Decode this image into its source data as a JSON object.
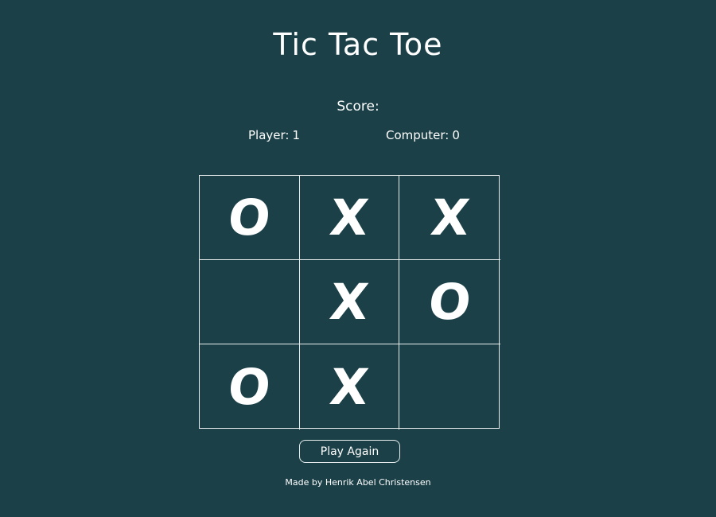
{
  "title": "Tic Tac Toe",
  "score": {
    "label": "Score:",
    "player_label": "Player:",
    "player_value": "1",
    "computer_label": "Computer:",
    "computer_value": "0"
  },
  "board": [
    [
      "O",
      "X",
      "X"
    ],
    [
      "",
      "X",
      "O"
    ],
    [
      "O",
      "X",
      ""
    ]
  ],
  "play_again_label": "Play Again",
  "footer": "Made by Henrik Abel Christensen",
  "colors": {
    "background": "#1b4048",
    "foreground": "#ffffff",
    "grid_line": "#e8eeee"
  }
}
